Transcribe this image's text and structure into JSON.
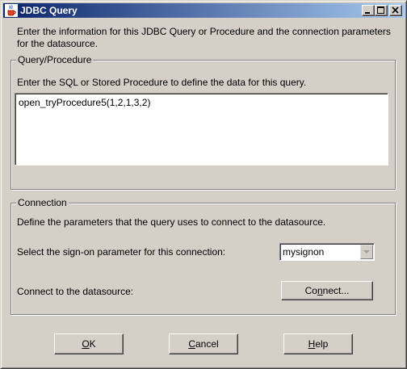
{
  "window": {
    "title": "JDBC Query",
    "title_icon": "java-cup-icon",
    "controls": [
      "minimize-icon",
      "maximize-icon",
      "close-icon"
    ]
  },
  "intro": {
    "line1": "Enter the information for this JDBC Query or Procedure and the connection parameters",
    "line2": "for the datasource."
  },
  "query_group": {
    "title": "Query/Procedure",
    "instruction": "Enter the SQL or Stored Procedure to define the data for this query.",
    "sql_text": "open_tryProcedure5(1,2,1,3,2)"
  },
  "connection_group": {
    "title": "Connection",
    "description": "Define the parameters that the query uses to connect to the datasource.",
    "signon_label": "Select the sign-on parameter for this connection:",
    "signon_value": "mysignon",
    "connect_label": "Connect to the datasource:",
    "connect_button": {
      "before": "Co",
      "mnemonic": "n",
      "after": "nect..."
    }
  },
  "buttons": {
    "ok": {
      "mnemonic": "O",
      "after": "K"
    },
    "cancel": {
      "mnemonic": "C",
      "after": "ancel"
    },
    "help": {
      "mnemonic": "H",
      "after": "elp"
    }
  }
}
